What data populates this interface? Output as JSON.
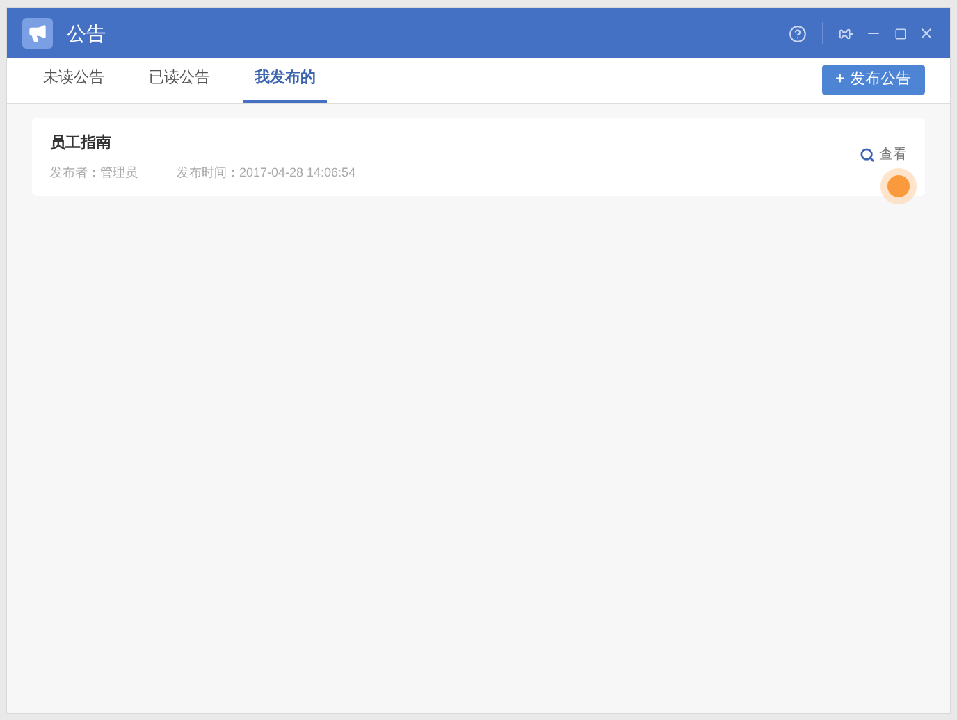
{
  "window": {
    "title": "公告"
  },
  "tabs": [
    {
      "label": "未读公告",
      "selected": false
    },
    {
      "label": "已读公告",
      "selected": false
    },
    {
      "label": "我发布的",
      "selected": true
    }
  ],
  "publish_button": {
    "icon": "+",
    "label": "发布公告"
  },
  "notices": [
    {
      "title": "员工指南",
      "publisher": "发布者：管理员",
      "time": "发布时间：2017-04-28 14:06:54",
      "action": "查看"
    }
  ]
}
